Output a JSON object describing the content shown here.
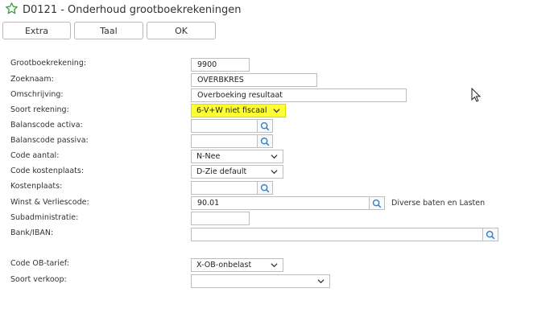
{
  "window": {
    "title": "D0121 - Onderhoud grootboekrekeningen",
    "star_icon": "star-icon",
    "accent": "#3a9a3a"
  },
  "toolbar": {
    "extra_label": "Extra",
    "taal_label": "Taal",
    "ok_label": "OK"
  },
  "form": {
    "grootboekrekening": {
      "label": "Grootboekrekening:",
      "value": "9900"
    },
    "zoeknaam": {
      "label": "Zoeknaam:",
      "value": "OVERBKRES"
    },
    "omschrijving": {
      "label": "Omschrijving:",
      "value": "Overboeking resultaat"
    },
    "soort_rekening": {
      "label": "Soort rekening:",
      "value": "6-V+W niet fiscaal",
      "highlight": "#ffff33"
    },
    "balanscode_activa": {
      "label": "Balanscode activa:",
      "value": ""
    },
    "balanscode_passiva": {
      "label": "Balanscode passiva:",
      "value": ""
    },
    "code_aantal": {
      "label": "Code aantal:",
      "value": "N-Nee"
    },
    "code_kostenplaats": {
      "label": "Code kostenplaats:",
      "value": "D-Zie default"
    },
    "kostenplaats": {
      "label": "Kostenplaats:",
      "value": ""
    },
    "winst_verlies": {
      "label": "Winst & Verliescode:",
      "value": "90.01",
      "description": "Diverse baten en Lasten"
    },
    "subadministratie": {
      "label": "Subadministratie:",
      "value": ""
    },
    "bank_iban": {
      "label": "Bank/IBAN:",
      "value": ""
    },
    "code_ob_tarief": {
      "label": "Code OB-tarief:",
      "value": "X-OB-onbelast"
    },
    "soort_verkoop": {
      "label": "Soort verkoop:",
      "value": ""
    }
  }
}
